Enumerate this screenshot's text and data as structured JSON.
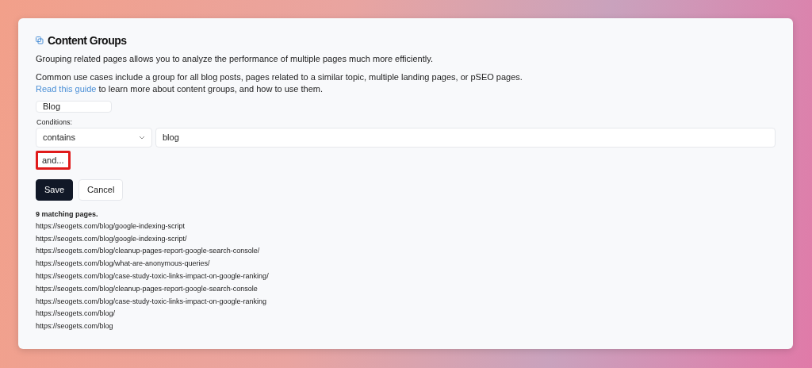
{
  "title": "Content Groups",
  "intro": "Grouping related pages allows you to analyze the performance of multiple pages much more efficiently.",
  "use_cases": "Common use cases include a group for all blog posts, pages related to a similar topic, multiple landing pages, or pSEO pages.",
  "guide": {
    "link": "Read this guide",
    "rest": " to learn more about content groups, and how to use them."
  },
  "name_field": {
    "value": "Blog"
  },
  "conditions": {
    "label": "Conditions:",
    "operator": "contains",
    "value": "blog"
  },
  "and_button": {
    "label": "and...",
    "highlighted": true
  },
  "buttons": [
    {
      "label": "Save",
      "kind": "primary"
    },
    {
      "label": "Cancel",
      "kind": "secondary"
    }
  ],
  "matches": {
    "count": "9 matching pages.",
    "urls": [
      "https://seogets.com/blog/google-indexing-script",
      "https://seogets.com/blog/google-indexing-script/",
      "https://seogets.com/blog/cleanup-pages-report-google-search-console/",
      "https://seogets.com/blog/what-are-anonymous-queries/",
      "https://seogets.com/blog/case-study-toxic-links-impact-on-google-ranking/",
      "https://seogets.com/blog/cleanup-pages-report-google-search-console",
      "https://seogets.com/blog/case-study-toxic-links-impact-on-google-ranking",
      "https://seogets.com/blog/",
      "https://seogets.com/blog"
    ]
  }
}
